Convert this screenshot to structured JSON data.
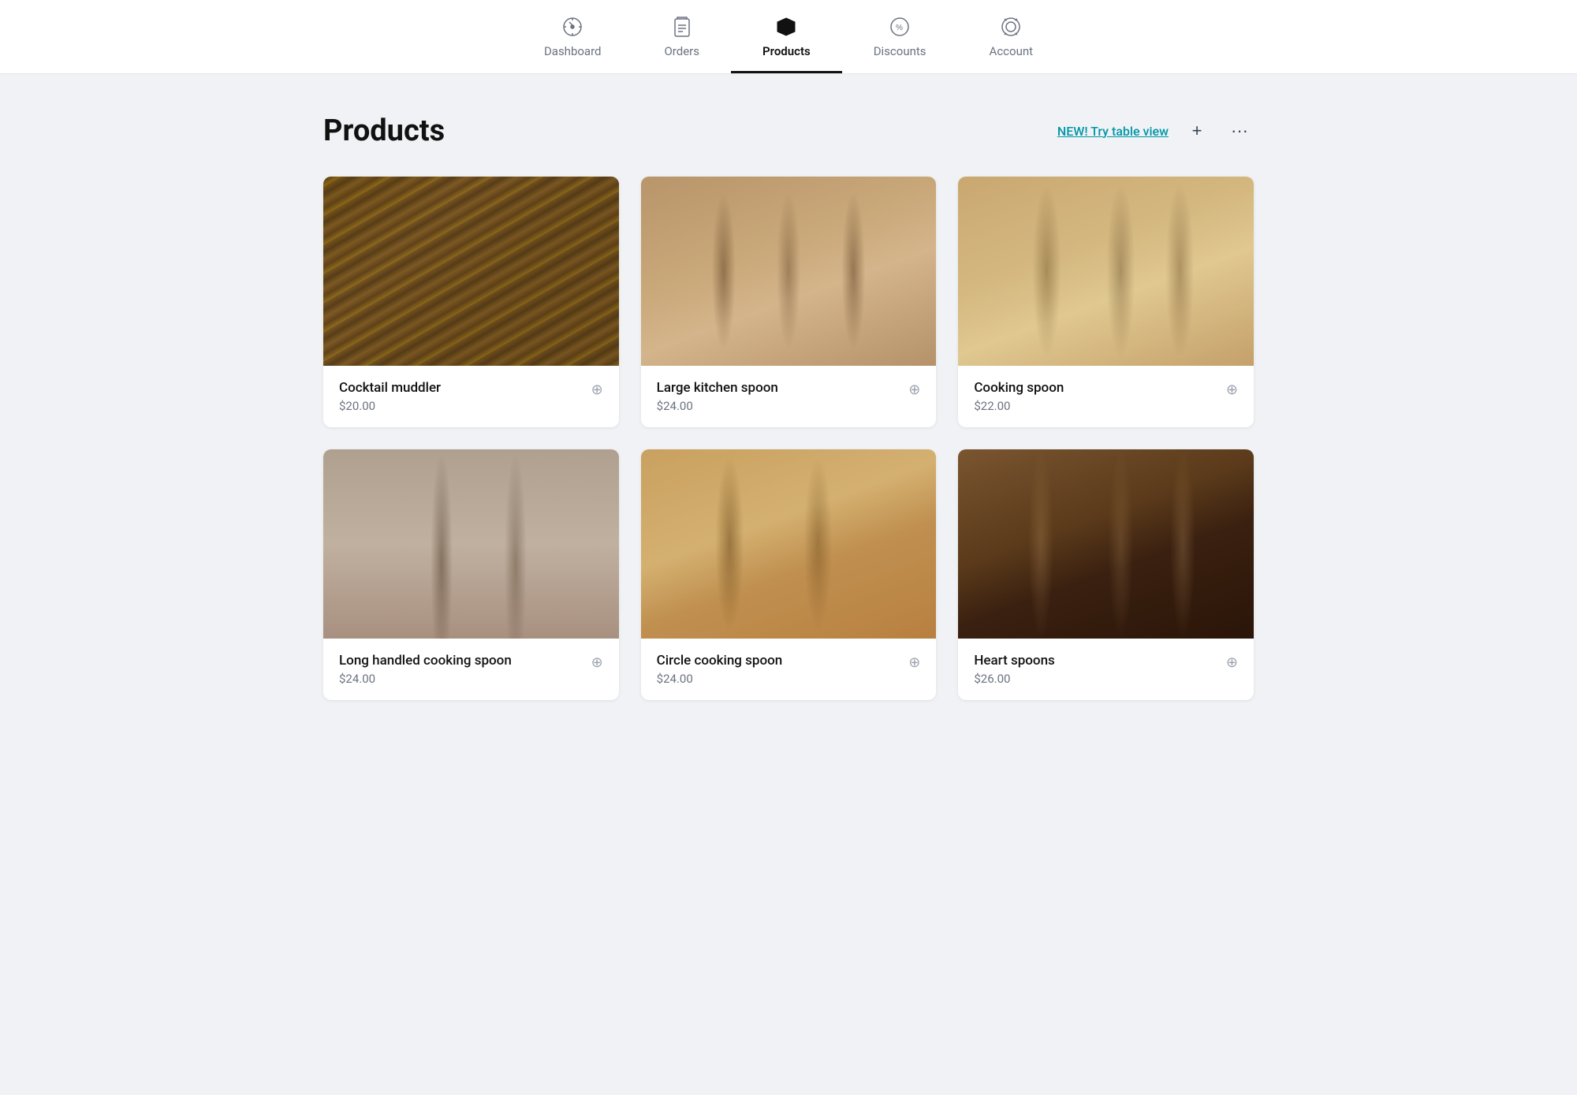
{
  "nav": {
    "items": [
      {
        "id": "dashboard",
        "label": "Dashboard",
        "active": false
      },
      {
        "id": "orders",
        "label": "Orders",
        "active": false
      },
      {
        "id": "products",
        "label": "Products",
        "active": true
      },
      {
        "id": "discounts",
        "label": "Discounts",
        "active": false
      },
      {
        "id": "account",
        "label": "Account",
        "active": false
      }
    ]
  },
  "header": {
    "page_title": "Products",
    "table_view_label": "NEW! Try table view",
    "add_label": "+",
    "more_label": "···"
  },
  "products": [
    {
      "id": "cocktail-muddler",
      "name": "Cocktail muddler",
      "price": "$20.00",
      "img_class": "img-muddler"
    },
    {
      "id": "large-kitchen-spoon",
      "name": "Large kitchen spoon",
      "price": "$24.00",
      "img_class": "img-large-spoon"
    },
    {
      "id": "cooking-spoon",
      "name": "Cooking spoon",
      "price": "$22.00",
      "img_class": "img-cooking-spoon"
    },
    {
      "id": "long-handled-cooking-spoon",
      "name": "Long handled cooking spoon",
      "price": "$24.00",
      "img_class": "img-long-spoon"
    },
    {
      "id": "circle-cooking-spoon",
      "name": "Circle cooking spoon",
      "price": "$24.00",
      "img_class": "img-circle-spoon"
    },
    {
      "id": "heart-spoons",
      "name": "Heart spoons",
      "price": "$26.00",
      "img_class": "img-heart-spoon"
    }
  ]
}
